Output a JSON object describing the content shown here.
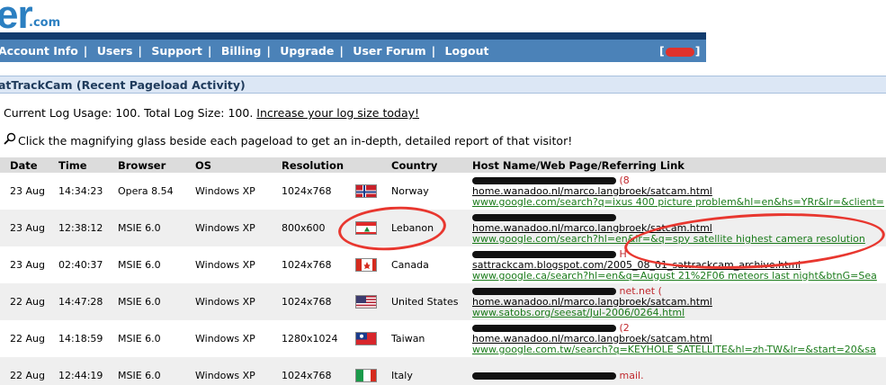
{
  "logo": {
    "big": "er",
    "com": ".com"
  },
  "nav": {
    "links": [
      "Account Info",
      "Users",
      "Support",
      "Billing",
      "Upgrade",
      "User Forum",
      "Logout"
    ],
    "right_open": "[",
    "right_close": "]"
  },
  "section_title": "atTrackCam (Recent Pageload Activity)",
  "usage": {
    "text": "Current Log Usage: 100. Total Log Size: 100. ",
    "link": "Increase your log size today!"
  },
  "hint": "Click the magnifying glass beside each pageload to get an in-depth, detailed report of that visitor!",
  "table": {
    "headers": [
      "Date",
      "Time",
      "Browser",
      "OS",
      "Resolution",
      "",
      "Country",
      "Host Name/Web Page/Referring Link"
    ],
    "rows": [
      {
        "date": "23 Aug",
        "time": "14:34:23",
        "browser": "Opera 8.54",
        "os": "Windows XP",
        "res": "1024x768",
        "flag": "norway",
        "country": "Norway",
        "host": "(8",
        "page": "home.wanadoo.nl/marco.langbroek/satcam.html",
        "ref": "www.google.com/search?q=ixus 400 picture problem&hl=en&hs=YRr&lr=&client="
      },
      {
        "date": "23 Aug",
        "time": "12:38:12",
        "browser": "MSIE 6.0",
        "os": "Windows XP",
        "res": "800x600",
        "flag": "lebanon",
        "country": "Lebanon",
        "host": "",
        "page": "home.wanadoo.nl/marco.langbroek/satcam.html",
        "ref": "www.google.com/search?hl=en&lr=&q=spy satellite highest camera resolution"
      },
      {
        "date": "23 Aug",
        "time": "02:40:37",
        "browser": "MSIE 6.0",
        "os": "Windows XP",
        "res": "1024x768",
        "flag": "canada",
        "country": "Canada",
        "host": "H",
        "page": "sattrackcam.blogspot.com/2005_08_01_sattrackcam_archive.html",
        "ref": "www.google.ca/search?hl=en&q=August 21%2F06 meteors last night&btnG=Sea"
      },
      {
        "date": "22 Aug",
        "time": "14:47:28",
        "browser": "MSIE 6.0",
        "os": "Windows XP",
        "res": "1024x768",
        "flag": "usa",
        "country": "United States",
        "host": "net.net (",
        "page": "home.wanadoo.nl/marco.langbroek/satcam.html",
        "ref": "www.satobs.org/seesat/Jul-2006/0264.html"
      },
      {
        "date": "22 Aug",
        "time": "14:18:59",
        "browser": "MSIE 6.0",
        "os": "Windows XP",
        "res": "1280x1024",
        "flag": "taiwan",
        "country": "Taiwan",
        "host": "(2",
        "page": "home.wanadoo.nl/marco.langbroek/satcam.html",
        "ref": "www.google.com.tw/search?q=KEYHOLE SATELLITE&hl=zh-TW&lr=&start=20&sa"
      },
      {
        "date": "22 Aug",
        "time": "12:44:19",
        "browser": "MSIE 6.0",
        "os": "Windows XP",
        "res": "1024x768",
        "flag": "italy",
        "country": "Italy",
        "host": "mail.",
        "page": "",
        "ref": ""
      }
    ]
  }
}
